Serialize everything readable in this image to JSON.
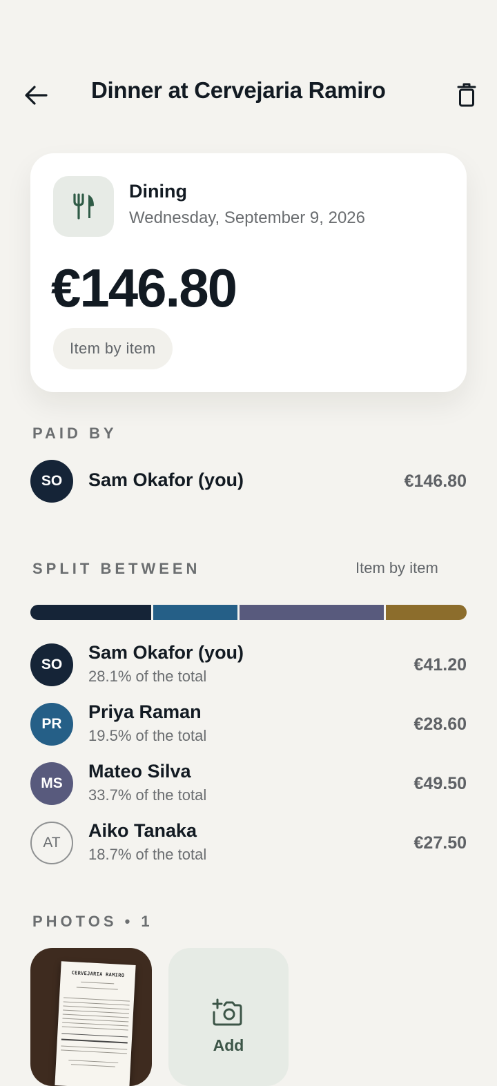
{
  "header": {
    "title": "Dinner at Cervejaria Ramiro",
    "back_icon": "arrow-left-icon",
    "delete_icon": "trash-icon"
  },
  "expense": {
    "category": "Dining",
    "category_icon": "fork-knife-icon",
    "date": "Wednesday, September 9, 2026",
    "amount": "€146.80",
    "split_method": "Item by item"
  },
  "paid_by": {
    "label": "PAID BY",
    "payer": {
      "initials": "SO",
      "name": "Sam Okafor (you)",
      "amount": "€146.80",
      "color": "#152437"
    }
  },
  "split": {
    "label": "SPLIT BETWEEN",
    "mode": "Item by item",
    "participants": [
      {
        "initials": "SO",
        "name": "Sam Okafor (you)",
        "share": "28.1% of the total",
        "share_fraction": 0.281,
        "amount": "€41.20",
        "color": "#152437"
      },
      {
        "initials": "PR",
        "name": "Priya Raman",
        "share": "19.5% of the total",
        "share_fraction": 0.195,
        "amount": "€28.60",
        "color": "#255f87"
      },
      {
        "initials": "MS",
        "name": "Mateo Silva",
        "share": "33.7% of the total",
        "share_fraction": 0.337,
        "amount": "€49.50",
        "color": "#585a7d"
      },
      {
        "initials": "AT",
        "name": "Aiko Tanaka",
        "share": "18.7% of the total",
        "share_fraction": 0.187,
        "amount": "€27.50",
        "color": "#8c6d2c"
      }
    ]
  },
  "photos": {
    "label": "PHOTOS • 1",
    "receipt_title": "CERVEJARIA RAMIRO",
    "add_label": "Add",
    "add_icon": "camera-plus-icon"
  }
}
